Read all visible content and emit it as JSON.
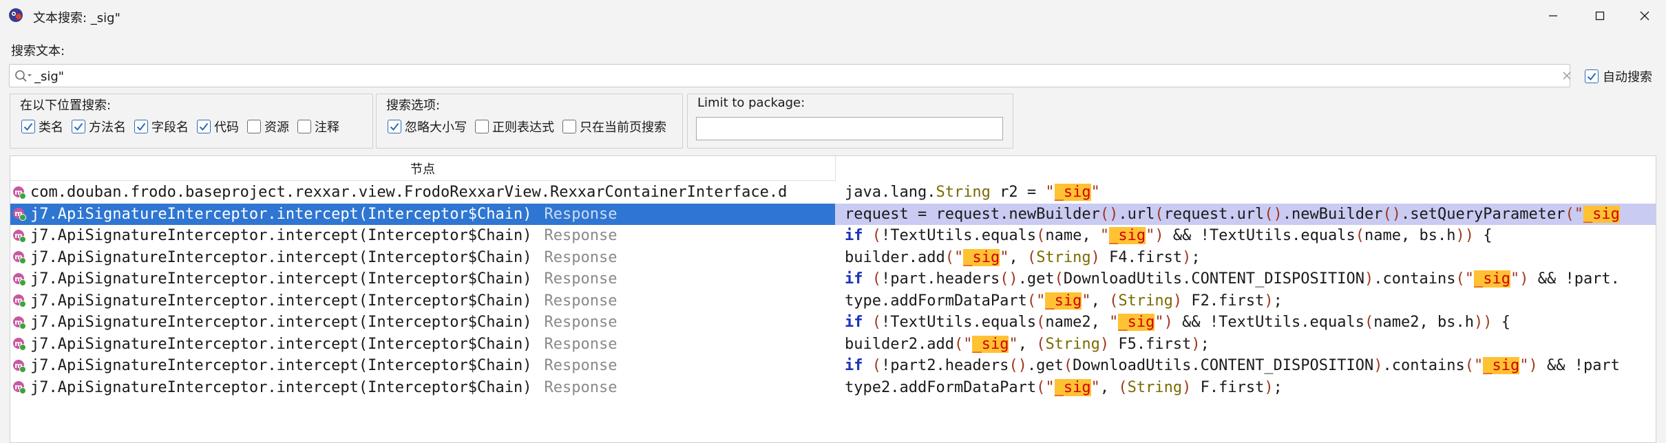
{
  "window": {
    "title": "文本搜索: _sig\"",
    "min_icon": "minimize-icon",
    "max_icon": "maximize-icon",
    "close_icon": "close-icon"
  },
  "search": {
    "label": "搜索文本:",
    "value": "_sig\"",
    "auto_search_label": "自动搜索",
    "auto_search_checked": true
  },
  "groups": {
    "location": {
      "title": "在以下位置搜索:",
      "options": [
        {
          "label": "类名",
          "checked": true
        },
        {
          "label": "方法名",
          "checked": true
        },
        {
          "label": "字段名",
          "checked": true
        },
        {
          "label": "代码",
          "checked": true
        },
        {
          "label": "资源",
          "checked": false
        },
        {
          "label": "注释",
          "checked": false
        }
      ]
    },
    "options": {
      "title": "搜索选项:",
      "options": [
        {
          "label": "忽略大小写",
          "checked": true
        },
        {
          "label": "正则表达式",
          "checked": false
        },
        {
          "label": "只在当前页搜索",
          "checked": false
        }
      ]
    },
    "package": {
      "title": "Limit to package:",
      "value": ""
    }
  },
  "results": {
    "header": "节点",
    "selected_index": 1,
    "rows": [
      {
        "node": "com.douban.frodo.baseproject.rexxar.view.FrodoRexxarView.RexxarContainerInterface.d",
        "sig": ""
      },
      {
        "node": "j7.ApiSignatureInterceptor.intercept(Interceptor$Chain)",
        "sig": "Response"
      },
      {
        "node": "j7.ApiSignatureInterceptor.intercept(Interceptor$Chain)",
        "sig": "Response"
      },
      {
        "node": "j7.ApiSignatureInterceptor.intercept(Interceptor$Chain)",
        "sig": "Response"
      },
      {
        "node": "j7.ApiSignatureInterceptor.intercept(Interceptor$Chain)",
        "sig": "Response"
      },
      {
        "node": "j7.ApiSignatureInterceptor.intercept(Interceptor$Chain)",
        "sig": "Response"
      },
      {
        "node": "j7.ApiSignatureInterceptor.intercept(Interceptor$Chain)",
        "sig": "Response"
      },
      {
        "node": "j7.ApiSignatureInterceptor.intercept(Interceptor$Chain)",
        "sig": "Response"
      },
      {
        "node": "j7.ApiSignatureInterceptor.intercept(Interceptor$Chain)",
        "sig": "Response"
      },
      {
        "node": "j7.ApiSignatureInterceptor.intercept(Interceptor$Chain)",
        "sig": "Response"
      }
    ],
    "code": [
      [
        [
          "t",
          "java.lang."
        ],
        [
          "ty",
          "String"
        ],
        [
          "t",
          " r2 = "
        ],
        [
          "str",
          "\""
        ],
        [
          "mark",
          "_sig"
        ],
        [
          "str",
          "\""
        ]
      ],
      [
        [
          "t",
          "request = request.newBuilder"
        ],
        [
          "par",
          "()"
        ],
        [
          "t",
          ".url"
        ],
        [
          "par",
          "("
        ],
        [
          "t",
          "request.url"
        ],
        [
          "par",
          "()"
        ],
        [
          "t",
          ".newBuilder"
        ],
        [
          "par",
          "()"
        ],
        [
          "t",
          ".setQueryParameter"
        ],
        [
          "par",
          "("
        ],
        [
          "str",
          "\""
        ],
        [
          "mark",
          "_sig"
        ]
      ],
      [
        [
          "kw",
          "if"
        ],
        [
          "t",
          " "
        ],
        [
          "par",
          "("
        ],
        [
          "t",
          "!TextUtils.equals"
        ],
        [
          "par",
          "("
        ],
        [
          "t",
          "name, "
        ],
        [
          "str",
          "\""
        ],
        [
          "mark",
          "_sig"
        ],
        [
          "str",
          "\""
        ],
        [
          "par",
          ")"
        ],
        [
          "t",
          " && !TextUtils.equals"
        ],
        [
          "par",
          "("
        ],
        [
          "t",
          "name, bs.h"
        ],
        [
          "par",
          "))"
        ],
        [
          "t",
          " {"
        ]
      ],
      [
        [
          "t",
          "builder.add"
        ],
        [
          "par",
          "("
        ],
        [
          "str",
          "\""
        ],
        [
          "mark",
          "_sig"
        ],
        [
          "str",
          "\""
        ],
        [
          "t",
          ", "
        ],
        [
          "par",
          "("
        ],
        [
          "ty",
          "String"
        ],
        [
          "par",
          ")"
        ],
        [
          "t",
          " F4.first"
        ],
        [
          "par",
          ")"
        ],
        [
          "t",
          ";"
        ]
      ],
      [
        [
          "kw",
          "if"
        ],
        [
          "t",
          " "
        ],
        [
          "par",
          "("
        ],
        [
          "t",
          "!part.headers"
        ],
        [
          "par",
          "()"
        ],
        [
          "t",
          ".get"
        ],
        [
          "par",
          "("
        ],
        [
          "t",
          "DownloadUtils.CONTENT_DISPOSITION"
        ],
        [
          "par",
          ")"
        ],
        [
          "t",
          ".contains"
        ],
        [
          "par",
          "("
        ],
        [
          "str",
          "\""
        ],
        [
          "mark",
          "_sig"
        ],
        [
          "str",
          "\""
        ],
        [
          "par",
          ")"
        ],
        [
          "t",
          " && !part."
        ]
      ],
      [
        [
          "t",
          "type.addFormDataPart"
        ],
        [
          "par",
          "("
        ],
        [
          "str",
          "\""
        ],
        [
          "mark",
          "_sig"
        ],
        [
          "str",
          "\""
        ],
        [
          "t",
          ", "
        ],
        [
          "par",
          "("
        ],
        [
          "ty",
          "String"
        ],
        [
          "par",
          ")"
        ],
        [
          "t",
          " F2.first"
        ],
        [
          "par",
          ")"
        ],
        [
          "t",
          ";"
        ]
      ],
      [
        [
          "kw",
          "if"
        ],
        [
          "t",
          " "
        ],
        [
          "par",
          "("
        ],
        [
          "t",
          "!TextUtils.equals"
        ],
        [
          "par",
          "("
        ],
        [
          "t",
          "name2, "
        ],
        [
          "str",
          "\""
        ],
        [
          "mark",
          "_sig"
        ],
        [
          "str",
          "\""
        ],
        [
          "par",
          ")"
        ],
        [
          "t",
          " && !TextUtils.equals"
        ],
        [
          "par",
          "("
        ],
        [
          "t",
          "name2, bs.h"
        ],
        [
          "par",
          "))"
        ],
        [
          "t",
          " {"
        ]
      ],
      [
        [
          "t",
          "builder2.add"
        ],
        [
          "par",
          "("
        ],
        [
          "str",
          "\""
        ],
        [
          "mark",
          "_sig"
        ],
        [
          "str",
          "\""
        ],
        [
          "t",
          ", "
        ],
        [
          "par",
          "("
        ],
        [
          "ty",
          "String"
        ],
        [
          "par",
          ")"
        ],
        [
          "t",
          " F5.first"
        ],
        [
          "par",
          ")"
        ],
        [
          "t",
          ";"
        ]
      ],
      [
        [
          "kw",
          "if"
        ],
        [
          "t",
          " "
        ],
        [
          "par",
          "("
        ],
        [
          "t",
          "!part2.headers"
        ],
        [
          "par",
          "()"
        ],
        [
          "t",
          ".get"
        ],
        [
          "par",
          "("
        ],
        [
          "t",
          "DownloadUtils.CONTENT_DISPOSITION"
        ],
        [
          "par",
          ")"
        ],
        [
          "t",
          ".contains"
        ],
        [
          "par",
          "("
        ],
        [
          "str",
          "\""
        ],
        [
          "mark",
          "_sig"
        ],
        [
          "str",
          "\""
        ],
        [
          "par",
          ")"
        ],
        [
          "t",
          " && !part"
        ]
      ],
      [
        [
          "t",
          "type2.addFormDataPart"
        ],
        [
          "par",
          "("
        ],
        [
          "str",
          "\""
        ],
        [
          "mark",
          "_sig"
        ],
        [
          "str",
          "\""
        ],
        [
          "t",
          ", "
        ],
        [
          "par",
          "("
        ],
        [
          "ty",
          "String"
        ],
        [
          "par",
          ")"
        ],
        [
          "t",
          " F.first"
        ],
        [
          "par",
          ")"
        ],
        [
          "t",
          ";"
        ]
      ]
    ]
  }
}
